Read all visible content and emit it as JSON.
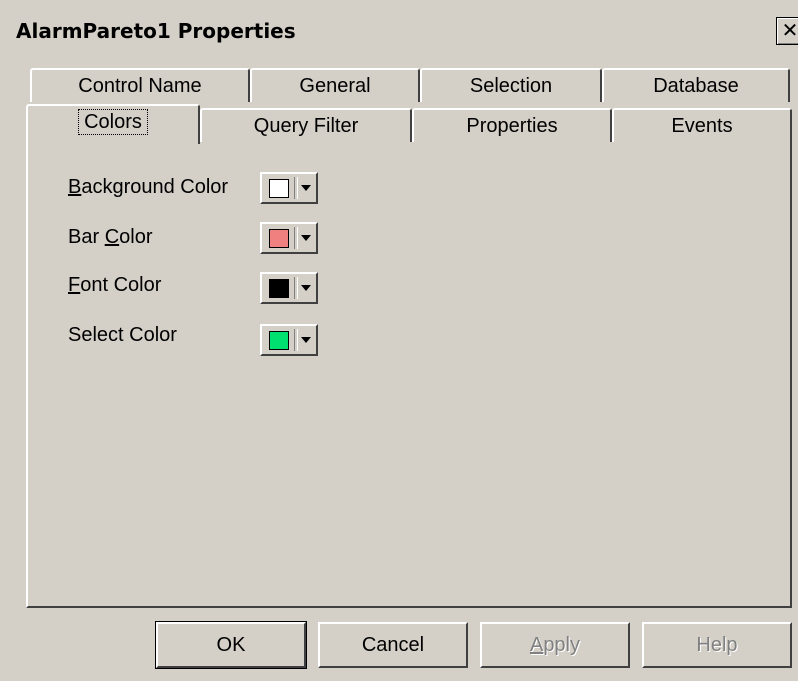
{
  "window": {
    "title": "AlarmPareto1 Properties",
    "close_glyph": "✕"
  },
  "tabs_back": [
    {
      "label": "Control Name"
    },
    {
      "label": "General"
    },
    {
      "label": "Selection"
    },
    {
      "label": "Database"
    }
  ],
  "tabs_front": [
    {
      "label": "Colors",
      "active": true
    },
    {
      "label": "Query Filter"
    },
    {
      "label": "Properties"
    },
    {
      "label": "Events"
    }
  ],
  "colors": [
    {
      "label_parts": [
        "",
        "B",
        "ackground Color"
      ],
      "color": "#ffffff"
    },
    {
      "label_parts": [
        "Bar ",
        "C",
        "olor"
      ],
      "color": "#f08080"
    },
    {
      "label_parts": [
        "",
        "F",
        "ont Color"
      ],
      "color": "#000000"
    },
    {
      "label_parts": [
        "Select Color",
        "",
        ""
      ],
      "color": "#00e070"
    }
  ],
  "buttons": {
    "ok": "OK",
    "cancel": "Cancel",
    "apply_parts": [
      "",
      "A",
      "pply"
    ],
    "help": "Help"
  },
  "theme": {
    "face": "#d4d0c8",
    "highlight": "#ffffff",
    "shadow": "#404040",
    "disabled_text": "#808080"
  }
}
